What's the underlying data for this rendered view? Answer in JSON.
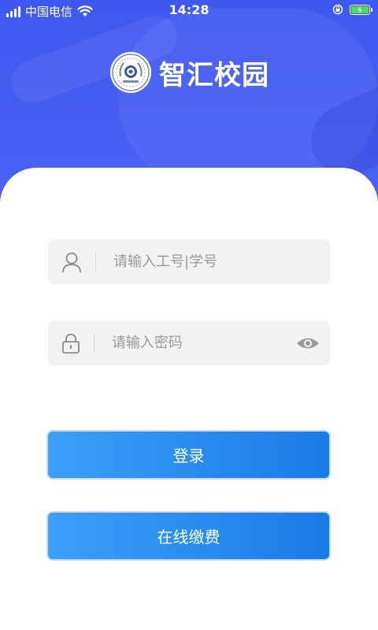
{
  "status_bar": {
    "carrier": "中国电信",
    "time": "14:28"
  },
  "app": {
    "name": "智汇校园"
  },
  "form": {
    "username_placeholder": "请输入工号|学号",
    "password_placeholder": "请输入密码"
  },
  "buttons": {
    "login": "登录",
    "pay": "在线缴费"
  },
  "icons": {
    "status_left": [
      "signal-icon",
      "wifi-icon"
    ],
    "status_right": [
      "rotation-lock-icon",
      "battery-charging-icon"
    ],
    "username": "user-icon",
    "password": "lock-icon",
    "toggle": "eye-icon"
  },
  "colors": {
    "header": "#4a62f4",
    "button": "#1a7be6",
    "field_bg": "#f2f2f2"
  }
}
